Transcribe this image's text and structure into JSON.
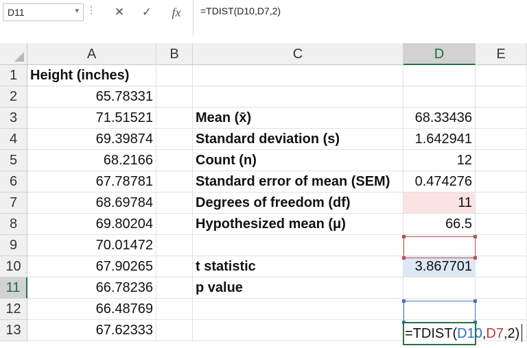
{
  "name_box": {
    "value": "D11",
    "dropdown_icon": "chevron-down-icon"
  },
  "formula_bar": {
    "cancel_symbol": "✕",
    "enter_symbol": "✓",
    "fx_symbol": "fx",
    "formula": "=TDIST(D10,D7,2)"
  },
  "columns": [
    "A",
    "B",
    "C",
    "D",
    "E"
  ],
  "selected_column": "D",
  "selected_row": "11",
  "rows": [
    {
      "num": "1",
      "a": "Height (inches)",
      "c": "",
      "d": ""
    },
    {
      "num": "2",
      "a": "65.78331",
      "c": "",
      "d": ""
    },
    {
      "num": "3",
      "a": "71.51521",
      "c": "Mean (x̄)",
      "d": "68.33436"
    },
    {
      "num": "4",
      "a": "69.39874",
      "c": "Standard deviation (s)",
      "d": "1.642941"
    },
    {
      "num": "5",
      "a": "68.2166",
      "c": "Count (n)",
      "d": "12"
    },
    {
      "num": "6",
      "a": "67.78781",
      "c": "Standard error of mean (SEM)",
      "d": "0.474276"
    },
    {
      "num": "7",
      "a": "68.69784",
      "c": "Degrees of freedom (df)",
      "d": "11"
    },
    {
      "num": "8",
      "a": "69.80204",
      "c": "Hypothesized mean (μ)",
      "d": "66.5"
    },
    {
      "num": "9",
      "a": "70.01472",
      "c": "",
      "d": ""
    },
    {
      "num": "10",
      "a": "67.90265",
      "c": "t statistic",
      "d": "3.867701"
    },
    {
      "num": "11",
      "a": "66.78236",
      "c": "p value",
      "d": ""
    },
    {
      "num": "12",
      "a": "66.48769",
      "c": "",
      "d": ""
    },
    {
      "num": "13",
      "a": "67.62333",
      "c": "",
      "d": ""
    }
  ],
  "active_cell_editor": {
    "prefix": "=TDIST(",
    "ref1": "D10",
    "sep1": ",",
    "ref2": "D7",
    "suffix": ",2)"
  },
  "colors": {
    "accent_green": "#217346",
    "ref_blue": "#4472c4",
    "ref_red": "#c0504d"
  }
}
